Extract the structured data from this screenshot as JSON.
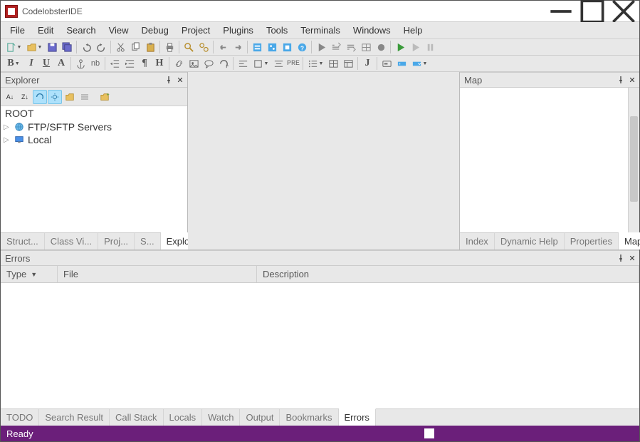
{
  "app": {
    "title": "CodelobsterIDE"
  },
  "menu": [
    "File",
    "Edit",
    "Search",
    "View",
    "Debug",
    "Project",
    "Plugins",
    "Tools",
    "Terminals",
    "Windows",
    "Help"
  ],
  "panels": {
    "explorer": {
      "title": "Explorer",
      "root": "ROOT",
      "items": [
        {
          "label": "FTP/SFTP Servers",
          "icon": "globe"
        },
        {
          "label": "Local",
          "icon": "monitor"
        }
      ],
      "tabs": [
        "Struct...",
        "Class Vi...",
        "Proj...",
        "S...",
        "Explo..."
      ],
      "active_tab": 4
    },
    "map": {
      "title": "Map",
      "tabs": [
        "Index",
        "Dynamic Help",
        "Properties",
        "Map"
      ],
      "active_tab": 3
    },
    "errors": {
      "title": "Errors",
      "columns": [
        "Type",
        "File",
        "Description"
      ],
      "tabs": [
        "TODO",
        "Search Result",
        "Call Stack",
        "Locals",
        "Watch",
        "Output",
        "Bookmarks",
        "Errors"
      ],
      "active_tab": 7
    }
  },
  "status": {
    "text": "Ready"
  }
}
